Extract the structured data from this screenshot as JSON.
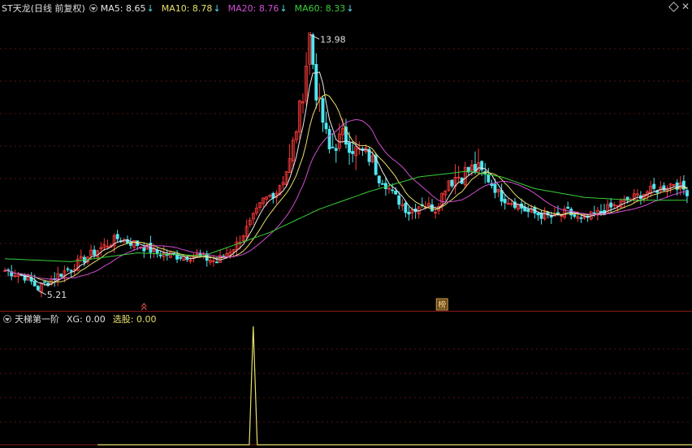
{
  "header": {
    "title": "ST天龙(日线 前复权)",
    "ma": [
      {
        "label": "MA5: 8.65",
        "color": "#e8e8e8",
        "arrow": "↓"
      },
      {
        "label": "MA10: 8.78",
        "color": "#e6e06a",
        "arrow": "↓"
      },
      {
        "label": "MA20: 8.76",
        "color": "#d14fd1",
        "arrow": "↓"
      },
      {
        "label": "MA60: 8.33",
        "color": "#38d038",
        "arrow": "↓"
      }
    ]
  },
  "indicator": {
    "name": "天梯第一阶",
    "xg": "XG: 0.00",
    "xuangu": "选股: 0.00"
  },
  "chart_data": {
    "type": "candlestick",
    "price_range": [
      4.6,
      14.6
    ],
    "high_label": "13.98",
    "low_label": "5.21",
    "marker_label": "榜",
    "colors": {
      "up": "#ff3b3b",
      "down": "#4fe6ef",
      "ma5": "#e8e8e8",
      "ma10": "#e6e06a",
      "ma20": "#d14fd1",
      "ma60": "#38d038",
      "signal": "#e6e06a"
    },
    "series_keypoints": [
      [
        0,
        5.9
      ],
      [
        6,
        5.7
      ],
      [
        10,
        5.3
      ],
      [
        14,
        5.6
      ],
      [
        20,
        6.0
      ],
      [
        28,
        6.6
      ],
      [
        34,
        7.0
      ],
      [
        40,
        6.8
      ],
      [
        46,
        6.5
      ],
      [
        52,
        6.4
      ],
      [
        58,
        6.4
      ],
      [
        64,
        6.2
      ],
      [
        70,
        6.8
      ],
      [
        74,
        7.5
      ],
      [
        78,
        8.3
      ],
      [
        82,
        8.6
      ],
      [
        86,
        9.6
      ],
      [
        90,
        12.0
      ],
      [
        92,
        13.98
      ],
      [
        94,
        12.0
      ],
      [
        96,
        11.0
      ],
      [
        98,
        10.0
      ],
      [
        102,
        10.5
      ],
      [
        106,
        10.0
      ],
      [
        110,
        9.8
      ],
      [
        114,
        9.0
      ],
      [
        118,
        8.4
      ],
      [
        122,
        7.9
      ],
      [
        126,
        8.2
      ],
      [
        130,
        8.0
      ],
      [
        134,
        9.0
      ],
      [
        138,
        9.2
      ],
      [
        142,
        9.4
      ],
      [
        146,
        9.0
      ],
      [
        150,
        8.4
      ],
      [
        154,
        8.2
      ],
      [
        158,
        7.9
      ],
      [
        162,
        7.8
      ],
      [
        166,
        7.7
      ],
      [
        170,
        7.9
      ],
      [
        174,
        7.6
      ],
      [
        178,
        7.8
      ],
      [
        182,
        8.0
      ],
      [
        186,
        8.2
      ],
      [
        190,
        8.4
      ],
      [
        194,
        8.6
      ],
      [
        198,
        8.7
      ],
      [
        202,
        8.9
      ],
      [
        206,
        8.6
      ]
    ],
    "ma60_keypoints": [
      [
        0,
        6.3
      ],
      [
        20,
        6.2
      ],
      [
        40,
        6.5
      ],
      [
        60,
        6.4
      ],
      [
        80,
        7.2
      ],
      [
        95,
        8.0
      ],
      [
        110,
        8.6
      ],
      [
        125,
        9.1
      ],
      [
        140,
        9.3
      ],
      [
        150,
        9.1
      ],
      [
        160,
        8.7
      ],
      [
        175,
        8.4
      ],
      [
        190,
        8.3
      ],
      [
        206,
        8.3
      ]
    ],
    "bar_count": 207,
    "signal_spike_index": 75,
    "signal_range": [
      0,
      1
    ]
  }
}
